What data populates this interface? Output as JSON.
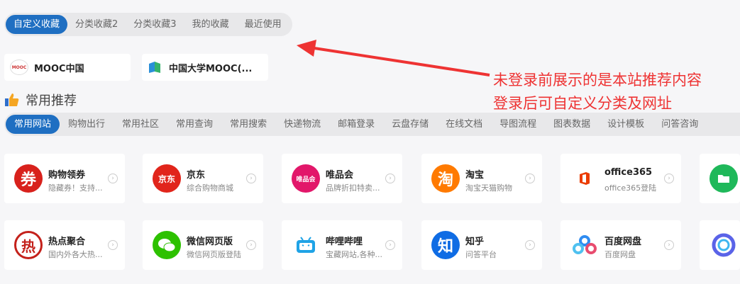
{
  "top_tabs": [
    "自定义收藏",
    "分类收藏2",
    "分类收藏3",
    "我的收藏",
    "最近使用"
  ],
  "sites": [
    {
      "name": "MOOC中国",
      "logo_text": "MOOC中国"
    },
    {
      "name": "中国大学MOOC(..."
    }
  ],
  "section": {
    "title": "常用推荐",
    "icon": "thumbs-up-icon"
  },
  "category_tabs": [
    "常用网站",
    "购物出行",
    "常用社区",
    "常用查询",
    "常用搜索",
    "快递物流",
    "邮箱登录",
    "云盘存储",
    "在线文档",
    "导图流程",
    "图表数据",
    "设计模板",
    "问答咨询"
  ],
  "cards": [
    {
      "title": "购物领券",
      "desc": "隐藏券！支持...",
      "icon": "coupon-icon",
      "glyph": "券",
      "color": "#d8211c"
    },
    {
      "title": "京东",
      "desc": "综合购物商城",
      "icon": "jd-icon",
      "glyph": "京东",
      "color": "#e1251b"
    },
    {
      "title": "唯品会",
      "desc": "品牌折扣特卖...",
      "icon": "vip-icon",
      "glyph": "唯品会",
      "color": "#e2176a"
    },
    {
      "title": "淘宝",
      "desc": "淘宝天猫购物",
      "icon": "taobao-icon",
      "glyph": "淘",
      "color": "#ff7a00"
    },
    {
      "title": "office365",
      "desc": "office365登陆",
      "icon": "office-icon",
      "glyph": "Office 365",
      "color": "#eb3c00"
    },
    {
      "title": "热点聚合",
      "desc": "国内外各大热...",
      "icon": "hot-icon",
      "glyph": "热",
      "color": "#c4211b"
    },
    {
      "title": "微信网页版",
      "desc": "微信网页版登陆",
      "icon": "wechat-icon",
      "glyph": "",
      "color": "#2dc100"
    },
    {
      "title": "哔哩哔哩",
      "desc": "宝藏网站,各种...",
      "icon": "bilibili-icon",
      "glyph": "",
      "color": "#1fa3e6"
    },
    {
      "title": "知乎",
      "desc": "问答平台",
      "icon": "zhihu-icon",
      "glyph": "知",
      "color": "#0f6ce4"
    },
    {
      "title": "百度网盘",
      "desc": "百度网盘",
      "icon": "baidu-pan-icon",
      "glyph": "",
      "color": "#2f8cf1"
    }
  ],
  "annotation": {
    "line1": "未登录前展示的是本站推荐内容",
    "line2": "登录后可自定义分类及网址"
  },
  "colors": {
    "accent": "#1f6fc2",
    "annotation": "#ee3333"
  }
}
